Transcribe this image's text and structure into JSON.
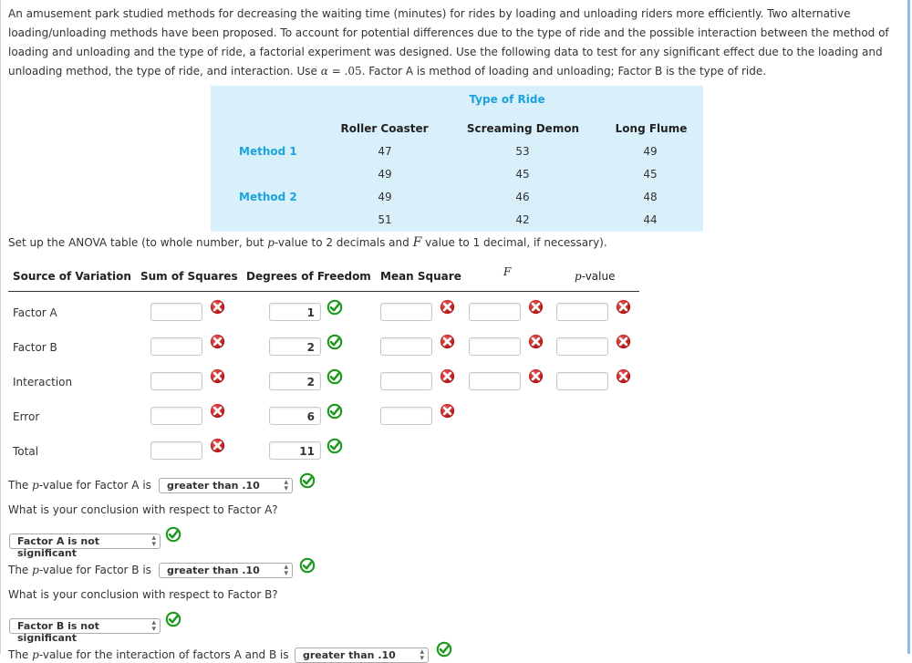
{
  "problem": {
    "intro_lines": [
      "An amusement park studied methods for decreasing the waiting time (minutes) for rides by loading and unloading riders more efficiently. Two alternative",
      "loading/unloading methods have been proposed. To account for potential differences due to the type of ride and the possible interaction between the method of",
      "loading and unloading and the type of ride, a factorial experiment was designed. Use the following data to test for any significant effect due to the loading and"
    ],
    "intro_last_before": "unloading method, the type of ride, and interaction. Use ",
    "alpha_symbol": "α",
    "alpha_eq": " = .05",
    "intro_last_after": ". Factor A is method of loading and unloading; Factor B is the type of ride."
  },
  "data_table": {
    "title": "Type of Ride",
    "columns": [
      "Roller Coaster",
      "Screaming Demon",
      "Long Flume"
    ],
    "rows": [
      {
        "label": "Method 1",
        "values": [
          47,
          53,
          49
        ]
      },
      {
        "label": "",
        "values": [
          49,
          45,
          45
        ]
      },
      {
        "label": "Method 2",
        "values": [
          49,
          46,
          48
        ]
      },
      {
        "label": "",
        "values": [
          51,
          42,
          44
        ]
      }
    ]
  },
  "setup": {
    "before_p": "Set up the ANOVA table (to whole number, but ",
    "p": "p",
    "mid": "-value to 2 decimals and ",
    "F": "F",
    "after": " value to 1 decimal, if necessary)."
  },
  "anova": {
    "headers": {
      "source": "Source of Variation",
      "ss": "Sum of Squares",
      "df": "Degrees of Freedom",
      "ms": "Mean Square",
      "f": "F",
      "p_italic": "p",
      "p_rest": "-value"
    },
    "rows": [
      {
        "source": "Factor A",
        "ss": "",
        "ss_status": "incorrect",
        "df": "1",
        "df_status": "correct",
        "ms": "",
        "ms_status": "incorrect",
        "f": "",
        "f_status": "incorrect",
        "p": "",
        "p_status": "incorrect"
      },
      {
        "source": "Factor B",
        "ss": "",
        "ss_status": "incorrect",
        "df": "2",
        "df_status": "correct",
        "ms": "",
        "ms_status": "incorrect",
        "f": "",
        "f_status": "incorrect",
        "p": "",
        "p_status": "incorrect"
      },
      {
        "source": "Interaction",
        "ss": "",
        "ss_status": "incorrect",
        "df": "2",
        "df_status": "correct",
        "ms": "",
        "ms_status": "incorrect",
        "f": "",
        "f_status": "incorrect",
        "p": "",
        "p_status": "incorrect"
      },
      {
        "source": "Error",
        "ss": "",
        "ss_status": "incorrect",
        "df": "6",
        "df_status": "correct",
        "ms": "",
        "ms_status": "incorrect"
      },
      {
        "source": "Total",
        "ss": "",
        "ss_status": "incorrect",
        "df": "11",
        "df_status": "correct"
      }
    ]
  },
  "questions": {
    "pA_before": "The ",
    "p": "p",
    "pA_after": "-value for Factor A is",
    "pA_select": "greater than .10",
    "concA_question": "What is your conclusion with respect to Factor A?",
    "concA_select": "Factor A is not significant",
    "pB_after": "-value for Factor B is",
    "pB_select": "greater than .10",
    "concB_question": "What is your conclusion with respect to Factor B?",
    "concB_select": "Factor B is not significant",
    "pAB_after": "-value for the interaction of factors A and B is",
    "pAB_select": "greater than .10"
  },
  "colors": {
    "accent": "#1aa3dc",
    "table_bg": "#d9f0fb",
    "correct": "#1e9a1e",
    "incorrect": "#cc1a1a"
  }
}
